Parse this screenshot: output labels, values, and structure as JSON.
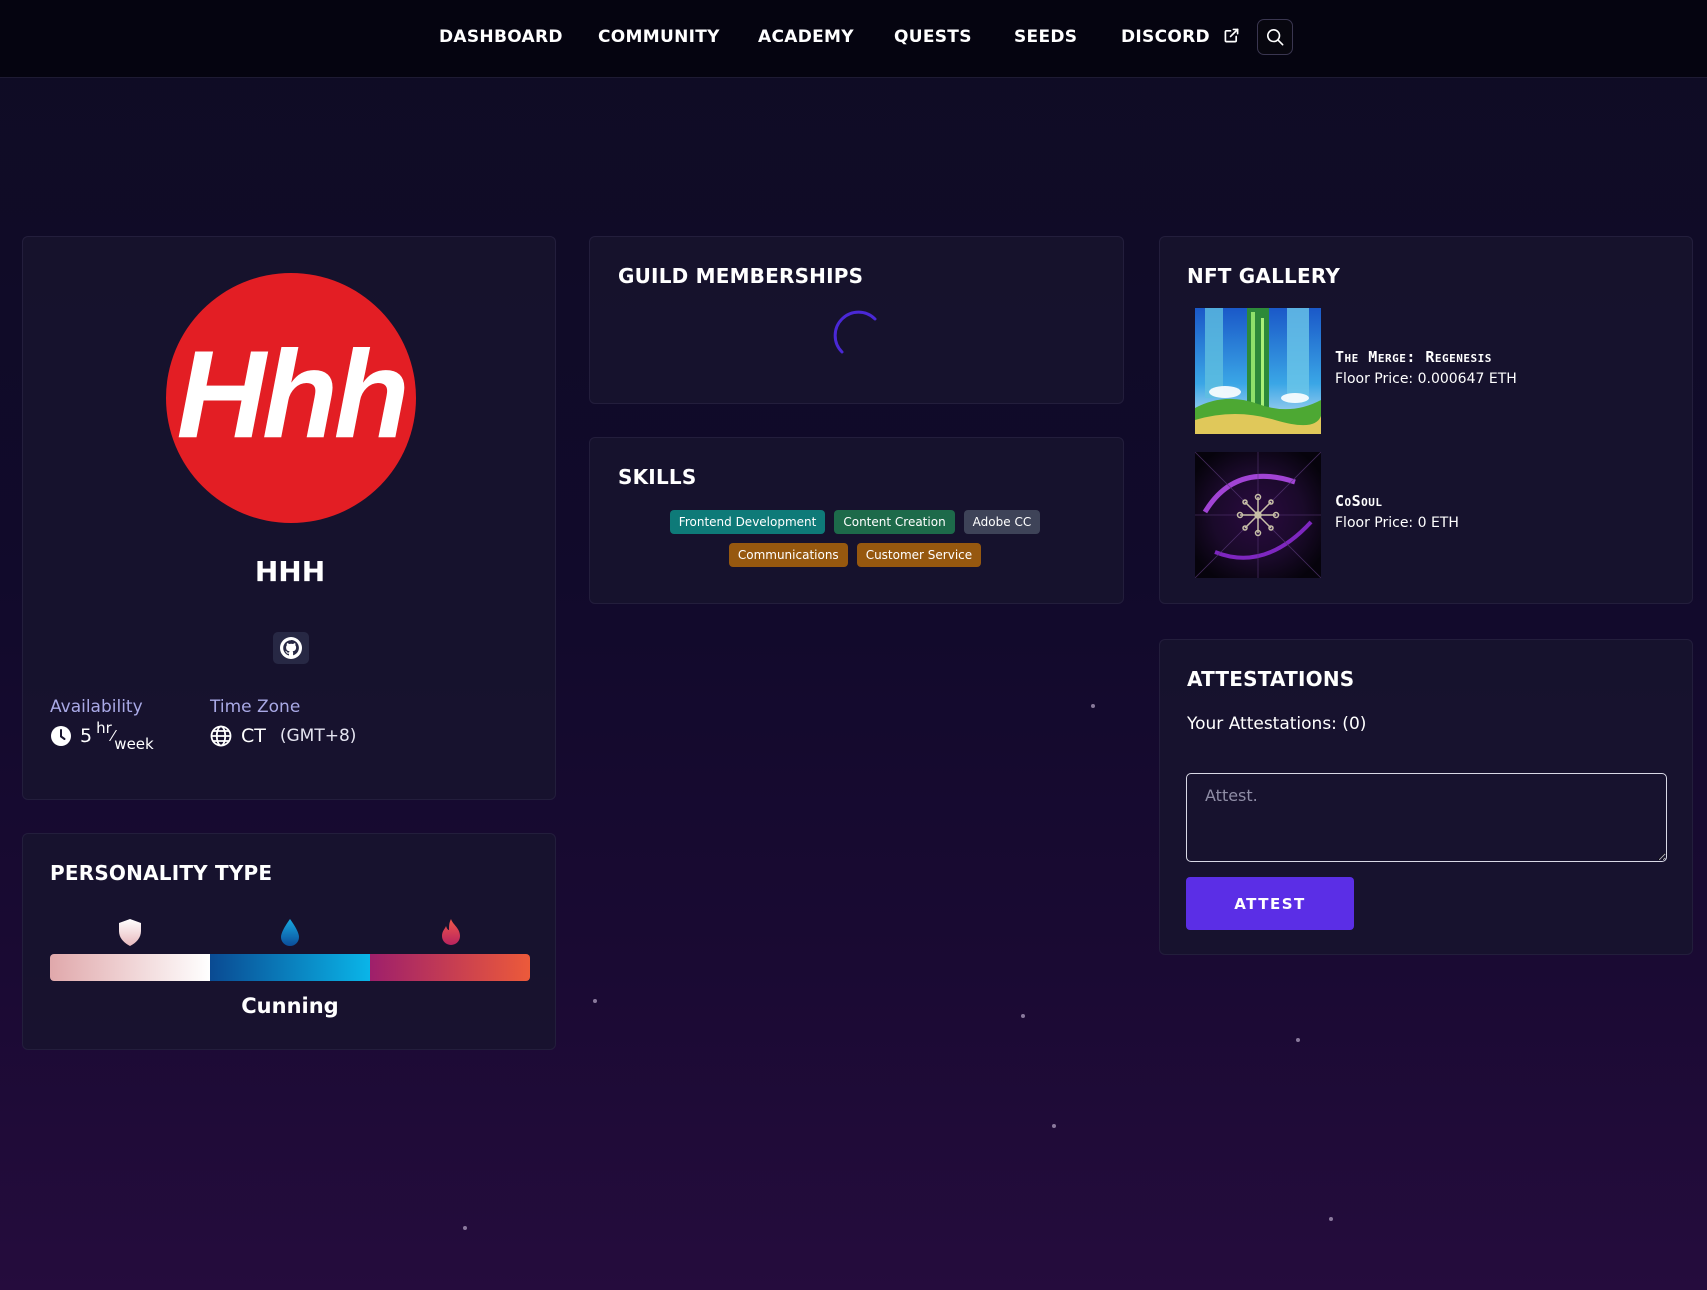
{
  "nav": {
    "items": [
      {
        "label": "DASHBOARD"
      },
      {
        "label": "COMMUNITY"
      },
      {
        "label": "ACADEMY"
      },
      {
        "label": "QUESTS"
      },
      {
        "label": "SEEDS"
      },
      {
        "label": "DISCORD"
      }
    ],
    "discord_icon": "external-link-icon",
    "search_icon": "search-icon"
  },
  "profile": {
    "avatar_text": "Hhh",
    "avatar_color": "#e31e24",
    "username": "HHH",
    "social_icon": "github-icon",
    "availability_label": "Availability",
    "availability_value": "5",
    "availability_unit_top": "hr",
    "availability_unit_bottom": "week",
    "timezone_label": "Time Zone",
    "timezone_value": "CT",
    "timezone_offset": "(GMT+8)"
  },
  "personality": {
    "title": "PERSONALITY TYPE",
    "icons": [
      "shield-icon",
      "water-drop-icon",
      "fire-icon"
    ],
    "result": "Cunning"
  },
  "guild": {
    "title": "GUILD MEMBERSHIPS",
    "loading": true
  },
  "skills": {
    "title": "SKILLS",
    "items": [
      {
        "label": "Frontend Development",
        "color": "#0e7a78"
      },
      {
        "label": "Content Creation",
        "color": "#1d6a4a"
      },
      {
        "label": "Adobe CC",
        "color": "#3e4358"
      },
      {
        "label": "Communications",
        "color": "#96580f"
      },
      {
        "label": "Customer Service",
        "color": "#96580f"
      }
    ]
  },
  "nft": {
    "title": "NFT GALLERY",
    "items": [
      {
        "name": "The Merge: Regenesis",
        "floor": "Floor Price: 0.000647 ETH"
      },
      {
        "name": "CoSoul",
        "floor": "Floor Price: 0 ETH"
      }
    ]
  },
  "attestations": {
    "title": "ATTESTATIONS",
    "count_text": "Your Attestations: (0)",
    "placeholder": "Attest.",
    "button_label": "ATTEST",
    "accent": "#5b2ee6"
  }
}
